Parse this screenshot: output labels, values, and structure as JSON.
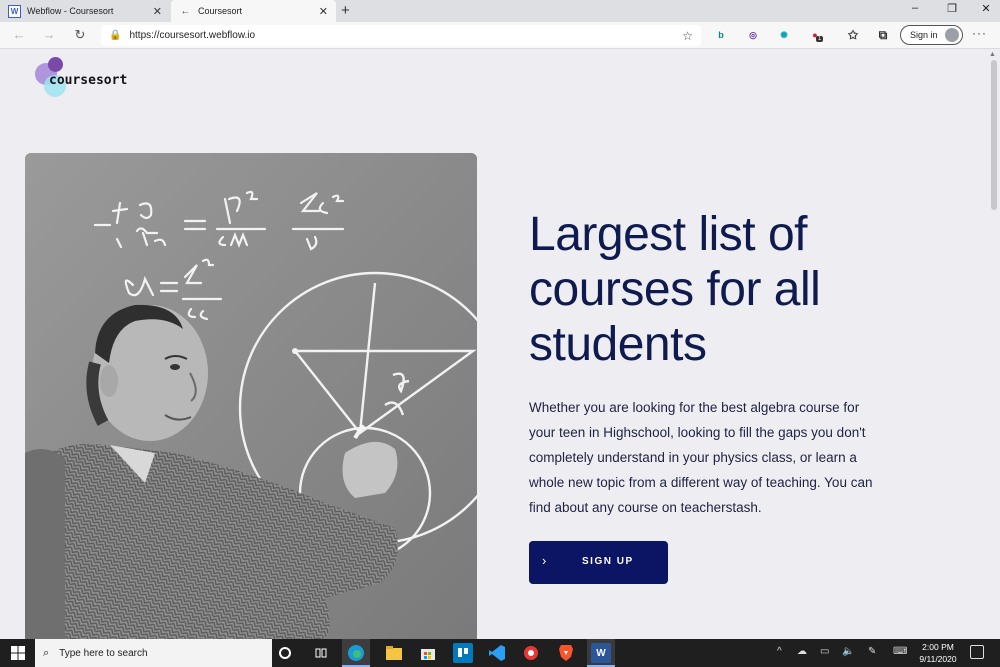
{
  "browser": {
    "tabs": [
      {
        "label": "Webflow - Coursesort",
        "favicon": "W",
        "close": "✕"
      },
      {
        "label": "Coursesort",
        "favicon": "←",
        "close": "✕"
      }
    ],
    "new_tab": "+",
    "window_controls": {
      "minimize": "–",
      "restore": "❐",
      "close": "✕"
    },
    "nav": {
      "back": "←",
      "forward": "→",
      "refresh": "↻"
    },
    "address": {
      "lock": "🔒",
      "url": "https://coursesort.webflow.io",
      "star": "☆"
    },
    "extensions": [
      {
        "name": "bing-icon",
        "glyph": "b",
        "color": "#0a8a7a"
      },
      {
        "name": "vpn-icon",
        "glyph": "◎",
        "color": "#6a3da8"
      },
      {
        "name": "globe-icon",
        "glyph": "✺",
        "color": "#13a3b8"
      },
      {
        "name": "adblock-icon",
        "glyph": "●",
        "color": "#d21f2e"
      }
    ],
    "ext_badge": "1",
    "favorites_icon": "✩",
    "collections_icon": "⧉",
    "signin_label": "Sign in",
    "more_label": "···"
  },
  "page": {
    "logo_text": "coursesort",
    "headline": "Largest list of courses for all students",
    "description": "Whether you are looking for the best algebra course for your teen in Highschool, looking to fill the gaps you don't completely understand in your physics class, or learn a whole new topic from a different way of teaching. You can find about any course on teacherstash.",
    "cta": {
      "chevron": "›",
      "label": "SIGN UP"
    },
    "scroll_up": "▲"
  },
  "taskbar": {
    "search_placeholder": "Type here to search",
    "search_icon": "⌕",
    "apps": [
      "cortana-icon",
      "task-view-icon",
      "edge-icon",
      "file-explorer-icon",
      "store-icon",
      "trello-icon",
      "vscode-icon",
      "record-icon",
      "brave-icon",
      "word-icon"
    ],
    "tray_chevron": "^",
    "time": "2:00 PM",
    "date": "9/11/2020"
  },
  "colors": {
    "headline": "#0f1a4f",
    "cta_bg": "#0c1464",
    "page_bg": "#eeeef2"
  }
}
